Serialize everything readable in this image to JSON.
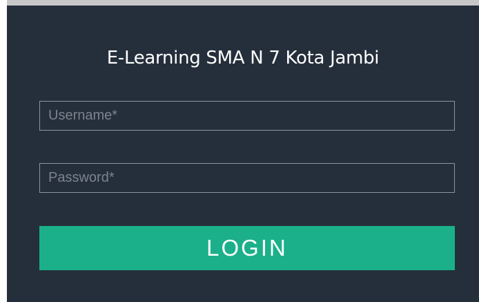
{
  "login": {
    "title": "E-Learning SMA N 7 Kota Jambi",
    "username": {
      "value": "",
      "placeholder": "Username*"
    },
    "password": {
      "value": "",
      "placeholder": "Password*"
    },
    "submit_label": "LOGIN"
  },
  "colors": {
    "panel_background": "#252f3b",
    "accent": "#1bb08a",
    "field_border": "#8e96a0",
    "placeholder_text": "#7b838d",
    "title_text": "#ffffff"
  }
}
